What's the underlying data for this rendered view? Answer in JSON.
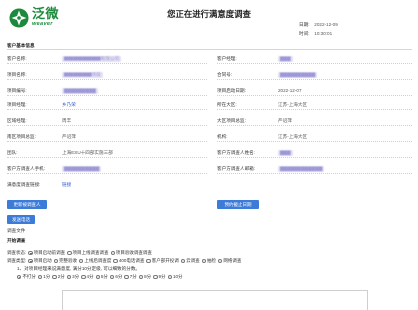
{
  "app": {
    "logo_cn": "泛微",
    "logo_en": "weaver",
    "title": "您正在进行满意度调查"
  },
  "meta": {
    "date_label": "日期:",
    "date_value": "2022-12-09",
    "time_label": "时间:",
    "time_value": "10:30:01"
  },
  "customer_section": {
    "title": "客户基本信息",
    "rows": [
      {
        "left_label": "客户名称:",
        "left_value": "▇▇▇▇▇▇▇▇有限公司",
        "right_label": "客户经理:",
        "right_value": "▇▇▇"
      },
      {
        "left_label": "项目名称:",
        "left_value": "▇▇▇▇▇▇项目",
        "right_label": "合同号:",
        "right_value": "▇▇▇▇▇▇▇▇▇▇"
      },
      {
        "left_label": "项目编号:",
        "left_value": "▇▇▇▇▇▇▇▇▇",
        "right_label": "项目启动日期:",
        "right_value": "2022-12-07"
      },
      {
        "left_label": "项目经理:",
        "left_value": "乡乃荣",
        "right_label": "所在大区:",
        "right_value": "江苏-上海大区"
      },
      {
        "left_label": "区域经理:",
        "left_value": "周丰",
        "right_label": "大区项目总监:",
        "right_value": "严诏萍"
      },
      {
        "left_label": "南区项目总监:",
        "left_value": "严诏萍",
        "right_label": "机构:",
        "right_value": "江苏-上海大区"
      },
      {
        "left_label": "团队:",
        "left_value": "上海ESU十四部实施三部",
        "right_label": "客户方调查人姓名:",
        "right_value": "▇▇▇"
      },
      {
        "left_label": "客户方调查人手机:",
        "left_value": "▇▇▇▇▇▇▇▇▇▇",
        "right_label": "客户方调查人邮箱:",
        "right_value": "▇▇▇▇▇▇▇▇▇▇▇▇"
      }
    ],
    "email_label": "满意度调查链接:",
    "email_value": "链接"
  },
  "buttons": {
    "update_contact": "更新被调查人",
    "extend_deadline": "预约截止日期",
    "open_link": "发送电话"
  },
  "survey": {
    "attach_label": "调查文件",
    "start_label": "开始调查",
    "type_label": "调查状态:",
    "type_options": [
      "项目启动前调查",
      "项目上线调查调查",
      "项目验收调查调查"
    ],
    "type_selected": 0,
    "cat_label": "调查类型:",
    "cat_options": [
      "项目启动",
      "完整验收",
      "上线后调查度",
      "400电话调查",
      "客户部开投调",
      "云调查",
      "抽检",
      "网络调查"
    ],
    "cat_selected": 0,
    "q1": "1、对项目经理来说满意度, 满分10分定级, 可以细致的分数。",
    "score_options": [
      "不打分",
      "1分",
      "2分",
      "3分",
      "4分",
      "5分",
      "6分",
      "7分",
      "8分",
      "9分",
      "10分"
    ],
    "score_selected": 0
  },
  "colors": {
    "brand": "#1b8a3c",
    "button": "#3d7bd8",
    "link": "#2a55c9"
  }
}
